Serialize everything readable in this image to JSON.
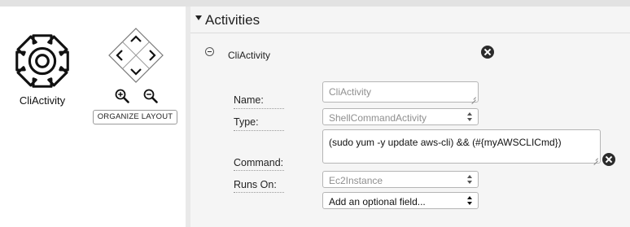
{
  "canvas": {
    "activity_node": {
      "label": "CliActivity",
      "icon": "gear-icon"
    },
    "pan_controls": [
      "pan-up-icon",
      "pan-left-icon",
      "pan-right-icon",
      "pan-down-icon"
    ],
    "zoom_in_icon": "zoom-in-icon",
    "zoom_out_icon": "zoom-out-icon",
    "organize_label": "ORGANIZE LAYOUT"
  },
  "panel": {
    "title": "Activities",
    "activity": {
      "name": "CliActivity",
      "fields": {
        "name_label": "Name:",
        "name_value": "CliActivity",
        "type_label": "Type:",
        "type_value": "ShellCommandActivity",
        "command_label": "Command:",
        "command_value": "(sudo yum -y update aws-cli) && (#{myAWSCLICmd})",
        "runs_on_label": "Runs On:",
        "runs_on_value": "Ec2Instance",
        "optional_field": "Add an optional field..."
      }
    }
  },
  "colors": {
    "panel_bg": "#f5f5f5",
    "topbar": "#e2e2e2",
    "close_icon": "#2b2b2b",
    "muted_text": "#8f8f8f"
  }
}
